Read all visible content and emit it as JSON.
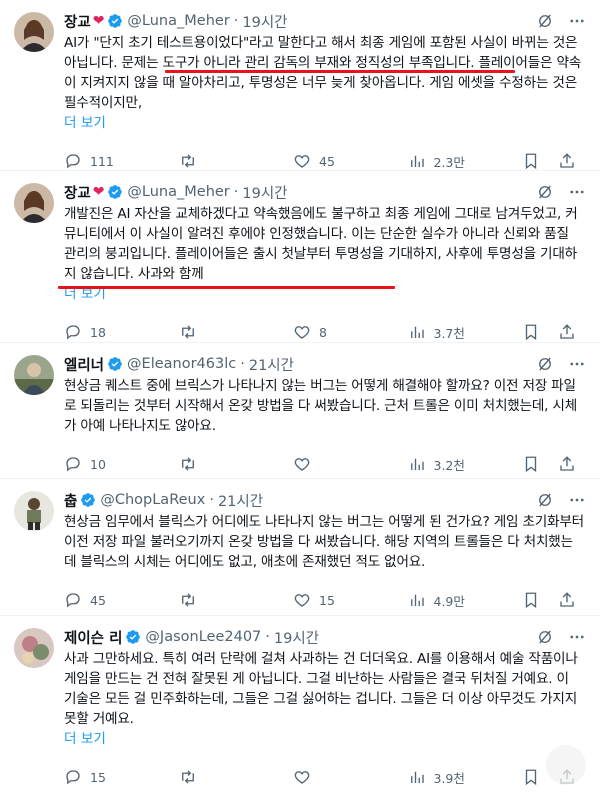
{
  "tweets": [
    {
      "name": "장교",
      "has_heart": true,
      "handle": "@Luna_Meher",
      "time": "19시간",
      "text": "AI가 \"단지 초기 테스트용이었다\"라고 말한다고 해서 최종 게임에 포함된 사실이 바뀌는 것은 아닙니다. 문제는 도구가 아니라 관리 감독의 부재와 정직성의 부족입니다. 플레이어들은 약속이 지켜지지 않을 때 알아차리고, 투명성은 너무 늦게 찾아옵니다. 게임 에셋을 수정하는 것은 필수적이지만,",
      "more": "더 보기",
      "replies": "111",
      "retweets": "",
      "likes": "45",
      "views": "2.3만"
    },
    {
      "name": "장교",
      "has_heart": true,
      "handle": "@Luna_Meher",
      "time": "19시간",
      "text": "개발진은 AI 자산을 교체하겠다고 약속했음에도 불구하고 최종 게임에 그대로 남겨두었고, 커뮤니티에서 이 사실이 알려진 후에야 인정했습니다. 이는 단순한 실수가 아니라 신뢰와 품질 관리의 붕괴입니다. 플레이어들은 출시 첫날부터 투명성을 기대하지, 사후에 투명성을 기대하지 않습니다. 사과와 함께",
      "more": "더 보기",
      "replies": "18",
      "retweets": "",
      "likes": "8",
      "views": "3.7천"
    },
    {
      "name": "엘리너",
      "has_heart": false,
      "handle": "@Eleanor463lc",
      "time": "21시간",
      "text": "현상금 퀘스트 중에 브릭스가 나타나지 않는 버그는 어떻게 해결해야 할까요? 이전 저장 파일로 되돌리는 것부터 시작해서 온갖 방법을 다 써봤습니다. 근처 트롤은 이미 처치했는데, 시체가 아예 나타나지도 않아요.",
      "more": "",
      "replies": "10",
      "retweets": "",
      "likes": "",
      "views": "3.2천"
    },
    {
      "name": "춥",
      "has_heart": false,
      "handle": "@ChopLaReux",
      "time": "21시간",
      "text": "현상금 임무에서 블릭스가 어디에도 나타나지 않는 버그는 어떻게 된 건가요? 게임 초기화부터 이전 저장 파일 불러오기까지 온갖 방법을 다 써봤습니다. 해당 지역의 트롤들은 다 처치했는데 블릭스의 시체는 어디에도 없고, 애초에 존재했던 적도 없어요.",
      "more": "",
      "replies": "45",
      "retweets": "",
      "likes": "15",
      "views": "4.9만"
    },
    {
      "name": "제이슨 리",
      "has_heart": false,
      "handle": "@JasonLee2407",
      "time": "19시간",
      "text": "사과 그만하세요. 특히 여러 단락에 걸쳐 사과하는 건 더더욱요. AI를 이용해서 예술 작품이나 게임을 만드는 건 전혀 잘못된 게 아닙니다. 그걸 비난하는 사람들은 결국 뒤처질 거예요. 이 기술은 모든 걸 민주화하는데, 그들은 그걸 싫어하는 겁니다. 그들은 더 이상 아무것도 가지지 못할 거예요.",
      "more": "더 보기",
      "replies": "15",
      "retweets": "",
      "likes": "",
      "views": "3.9천"
    }
  ],
  "colors": {
    "accent": "#1d9bf0",
    "muted": "#536471",
    "highlight_line": "#e8141c",
    "heart": "#e0245e"
  },
  "icons": [
    "verified-badge-icon",
    "grok-icon",
    "more-icon",
    "reply-icon",
    "retweet-icon",
    "like-icon",
    "views-icon",
    "bookmark-icon",
    "share-icon"
  ]
}
